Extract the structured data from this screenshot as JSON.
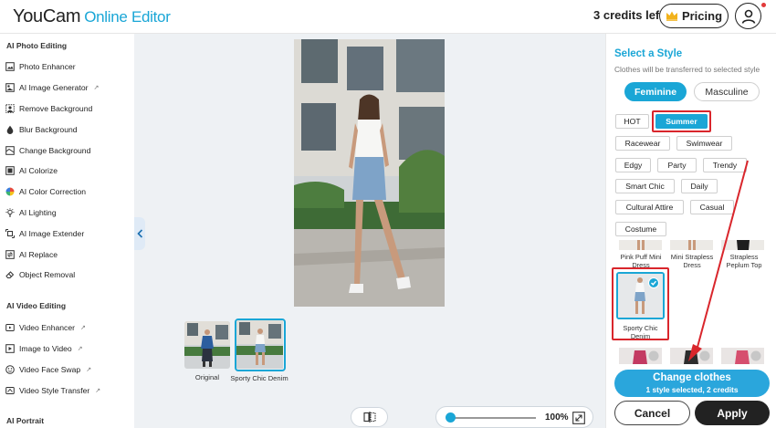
{
  "header": {
    "brand": "YouCam",
    "brand_sub": "Online Editor",
    "credits": "3 credits left",
    "pricing_label": "Pricing"
  },
  "sidebar": {
    "sections": [
      {
        "title": "AI Photo Editing",
        "items": [
          {
            "label": "Photo Enhancer",
            "icon": "photo-enhancer-icon",
            "external": false
          },
          {
            "label": "AI Image Generator",
            "icon": "image-generator-icon",
            "external": true
          },
          {
            "label": "Remove Background",
            "icon": "remove-background-icon",
            "external": false
          },
          {
            "label": "Blur Background",
            "icon": "blur-icon",
            "external": false
          },
          {
            "label": "Change Background",
            "icon": "change-background-icon",
            "external": false
          },
          {
            "label": "AI Colorize",
            "icon": "colorize-icon",
            "external": false
          },
          {
            "label": "AI Color Correction",
            "icon": "color-wheel-icon",
            "external": false
          },
          {
            "label": "AI Lighting",
            "icon": "lightbulb-icon",
            "external": false
          },
          {
            "label": "AI Image Extender",
            "icon": "extender-icon",
            "external": false
          },
          {
            "label": "AI Replace",
            "icon": "replace-icon",
            "external": false
          },
          {
            "label": "Object Removal",
            "icon": "eraser-icon",
            "external": false
          }
        ]
      },
      {
        "title": "AI Video Editing",
        "items": [
          {
            "label": "Video Enhancer",
            "icon": "video-enhancer-icon",
            "external": true
          },
          {
            "label": "Image to Video",
            "icon": "image-to-video-icon",
            "external": true
          },
          {
            "label": "Video Face Swap",
            "icon": "face-swap-icon",
            "external": true
          },
          {
            "label": "Video Style Transfer",
            "icon": "style-transfer-icon",
            "external": true
          }
        ]
      },
      {
        "title": "AI Portrait",
        "items": []
      }
    ]
  },
  "canvas": {
    "thumbnails": [
      {
        "label": "Original",
        "selected": false
      },
      {
        "label": "Sporty Chic Denim",
        "selected": true
      }
    ],
    "zoom": "100%"
  },
  "panel": {
    "title": "Select a Style",
    "subtitle": "Clothes will be transferred to selected style",
    "gender_tabs": [
      {
        "label": "Feminine",
        "active": true
      },
      {
        "label": "Masculine",
        "active": false
      }
    ],
    "categories": [
      "HOT",
      "Summer",
      "Racewear",
      "Swimwear",
      "Edgy",
      "Party",
      "Trendy",
      "Smart Chic",
      "Daily",
      "Cultural Attire",
      "Casual",
      "Costume"
    ],
    "selected_category": "Summer",
    "styles": [
      {
        "label": "Pink Puff Mini Dress"
      },
      {
        "label": "Mini Strapless Dress"
      },
      {
        "label": "Strapless Peplum Top"
      },
      {
        "label": "Sporty Chic Denim",
        "selected": true
      }
    ],
    "change_button": {
      "label": "Change clothes",
      "sub": "1 style selected, 2 credits"
    },
    "cancel_label": "Cancel",
    "apply_label": "Apply"
  },
  "colors": {
    "accent": "#1aa6d6",
    "highlight": "#d9262c",
    "dark": "#222222"
  }
}
